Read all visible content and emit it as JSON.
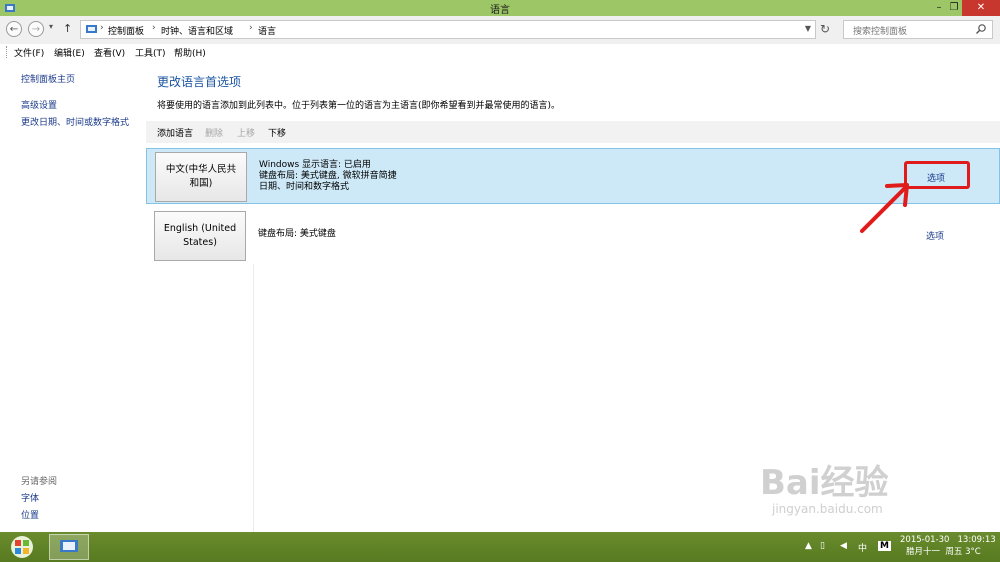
{
  "window": {
    "title": "语言",
    "minimize": "–",
    "maximize": "❐",
    "close": "✕"
  },
  "nav": {
    "back": "←",
    "forward": "→",
    "up": "↑",
    "breadcrumbs": [
      "控制面板",
      "时钟、语言和区域",
      "语言"
    ],
    "search_placeholder": "搜索控制面板"
  },
  "menu": [
    "文件(F)",
    "编辑(E)",
    "查看(V)",
    "工具(T)",
    "帮助(H)"
  ],
  "sidebar": {
    "home": "控制面板主页",
    "links": [
      "高级设置",
      "更改日期、时间或数字格式"
    ],
    "see_also_title": "另请参阅",
    "see_also": [
      "字体",
      "位置"
    ]
  },
  "main": {
    "heading": "更改语言首选项",
    "description": "将要使用的语言添加到此列表中。位于列表第一位的语言为主语言(即你希望看到并最常使用的语言)。",
    "toolbar": {
      "add": "添加语言",
      "remove": "删除",
      "up": "上移",
      "down": "下移"
    },
    "languages": [
      {
        "name": "中文(中华人民共和国)",
        "info": [
          "Windows 显示语言: 已启用",
          "键盘布局: 美式键盘, 微软拼音简捷",
          "日期、时间和数字格式"
        ],
        "options": "选项"
      },
      {
        "name": "English (United States)",
        "info": [
          "键盘布局: 美式键盘"
        ],
        "options": "选项"
      }
    ]
  },
  "taskbar": {
    "ime": "中",
    "ime_mode": "M",
    "date": "2015-01-30",
    "time": "13:09:13",
    "lunar": "腊月十一",
    "weekday_temp": "周五 3°C"
  },
  "watermark": {
    "brand": "Bai经验",
    "url": "jingyan.baidu.com"
  },
  "colors": {
    "titlebar": "#9dc767",
    "selected_row": "#cde8f7",
    "highlight": "#e01b1b",
    "link": "#1a3a8b"
  }
}
